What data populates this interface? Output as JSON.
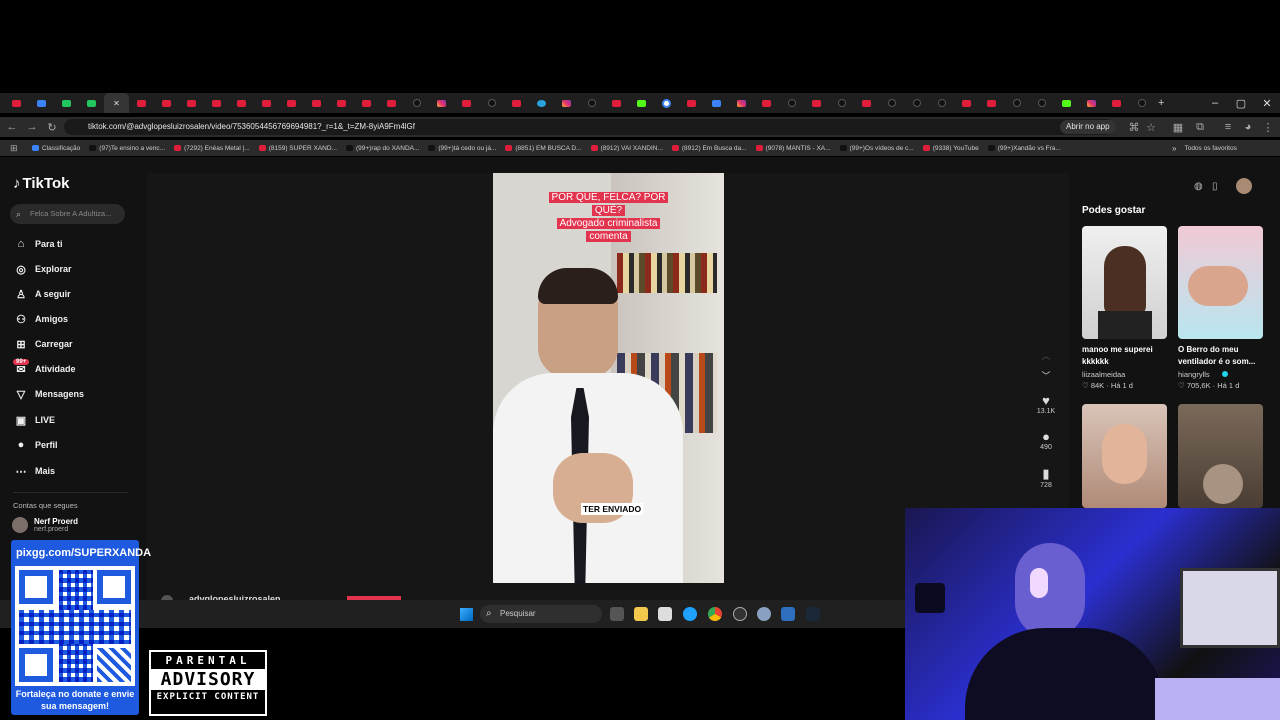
{
  "browser": {
    "tabs": [
      "yt",
      "blue",
      "green",
      "green",
      "active",
      "yt",
      "yt",
      "yt",
      "yt",
      "yt",
      "yt",
      "yt",
      "yt",
      "yt",
      "yt",
      "yt",
      "tt",
      "ig",
      "yt",
      "tt",
      "yt",
      "tg",
      "ig",
      "tt",
      "yt",
      "k",
      "g",
      "yt",
      "blue",
      "ig",
      "yt",
      "tt",
      "yt",
      "tt",
      "yt",
      "tt",
      "tt",
      "tt",
      "yt",
      "yt",
      "tt",
      "tt",
      "k",
      "ig",
      "yt",
      "tt"
    ],
    "url": "tiktok.com/@advglopesluizrosalen/video/7536054456769694981?_r=1&_t=ZM-8yiA9Fm4lGf",
    "open_app": "Abrir no app",
    "bookmarks": [
      {
        "label": "Classificação",
        "color": "#3b82f6"
      },
      {
        "label": "(97)Te ensino a venc...",
        "color": "#111"
      },
      {
        "label": "(7292) Enéas Metal |...",
        "color": "#e01e3c"
      },
      {
        "label": "(8159) SUPER XAND...",
        "color": "#e01e3c"
      },
      {
        "label": "(99+)rap do XANDÃ...",
        "color": "#111"
      },
      {
        "label": "(99+)tá cedo ou já...",
        "color": "#111"
      },
      {
        "label": "(8851) EM BUSCA D...",
        "color": "#e01e3c"
      },
      {
        "label": "(8912) VAI XANDIN...",
        "color": "#e01e3c"
      },
      {
        "label": "(8912) Em Busca da...",
        "color": "#e01e3c"
      },
      {
        "label": "(9078) MANTIS - XA...",
        "color": "#e01e3c"
      },
      {
        "label": "(99+)Os vídeos de c...",
        "color": "#111"
      },
      {
        "label": "(9338) YouTube",
        "color": "#e01e3c"
      },
      {
        "label": "(99+)Xandão vs Fra...",
        "color": "#111"
      }
    ],
    "all_favorites": "Todos os favoritos"
  },
  "tiktok": {
    "logo": "TikTok",
    "search_placeholder": "Felca Sobre A Adultiza...",
    "nav": [
      {
        "label": "Para ti",
        "icon": "home-icon",
        "glyph": "⌂"
      },
      {
        "label": "Explorar",
        "icon": "compass-icon",
        "glyph": "◎"
      },
      {
        "label": "A seguir",
        "icon": "following-icon",
        "glyph": "♙"
      },
      {
        "label": "Amigos",
        "icon": "friends-icon",
        "glyph": "⚇"
      },
      {
        "label": "Carregar",
        "icon": "upload-icon",
        "glyph": "⊞"
      },
      {
        "label": "Atividade",
        "icon": "activity-icon",
        "glyph": "✉"
      },
      {
        "label": "Mensagens",
        "icon": "messages-icon",
        "glyph": "▽"
      },
      {
        "label": "LIVE",
        "icon": "live-icon",
        "glyph": "▣"
      },
      {
        "label": "Perfil",
        "icon": "profile-icon",
        "glyph": "●"
      },
      {
        "label": "Mais",
        "icon": "more-icon",
        "glyph": "⋯"
      }
    ],
    "activity_badge": "99+",
    "following_title": "Contas que segues",
    "following": {
      "name": "Nerf Proerd",
      "handle": "nerf.proerd"
    },
    "video": {
      "caption_lines": [
        "POR QUE, FELCA? POR",
        "QUÊ?",
        "Advogado criminalista",
        "comenta"
      ],
      "subtitle": "TER ENVIADO",
      "author": "advglopesluizrosalen"
    },
    "rail": {
      "likes": "13.1K",
      "comments": "490",
      "saves": "728"
    },
    "recommend_title": "Podes gostar",
    "recommendations": [
      {
        "title": "manoo me superei kkkkkk",
        "user": "liizaalmeidaa",
        "likes": "84K",
        "age": "Há 1 d"
      },
      {
        "title": "O Berro do meu ventilador é o som...",
        "user": "hiangrylls",
        "likes": "705,6K",
        "age": "Há 1 d"
      }
    ]
  },
  "taskbar": {
    "search_label": "Pesquisar"
  },
  "overlay": {
    "donate_url": "pixgg.com/SUPERXANDA",
    "donate_caption": "Fortaleça no donate e envie sua mensagem!",
    "advisory": {
      "line1": "PARENTAL",
      "line2": "ADVISORY",
      "line3": "EXPLICIT CONTENT"
    }
  }
}
